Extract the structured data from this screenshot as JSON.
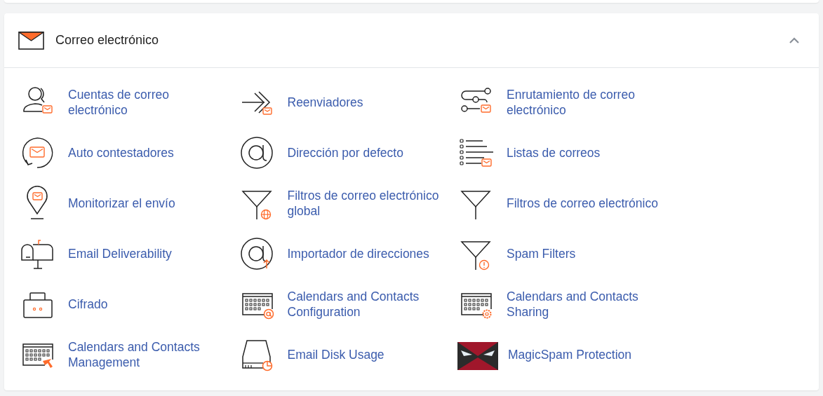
{
  "section": {
    "title": "Correo electrónico",
    "expanded": true
  },
  "items": [
    {
      "label": "Cuentas de correo electrónico",
      "kind": "user-mail"
    },
    {
      "label": "Reenviadores",
      "kind": "forward-mail"
    },
    {
      "label": "Enrutamiento de correo electrónico",
      "kind": "route-mail"
    },
    {
      "label": "Auto contestadores",
      "kind": "autoreply"
    },
    {
      "label": "Dirección por defecto",
      "kind": "at"
    },
    {
      "label": "Listas de correos",
      "kind": "list-mail"
    },
    {
      "label": "Monitorizar el envío",
      "kind": "pin-mail"
    },
    {
      "label": "Filtros de correo electrónico global",
      "kind": "filter-globe"
    },
    {
      "label": "Filtros de correo electrónico",
      "kind": "filter"
    },
    {
      "label": "Email Deliverability",
      "kind": "mailbox"
    },
    {
      "label": "Importador de direcciones",
      "kind": "at-upload"
    },
    {
      "label": "Spam Filters",
      "kind": "filter-alert"
    },
    {
      "label": "Cifrado",
      "kind": "lock"
    },
    {
      "label": "Calendars and Contacts Configuration",
      "kind": "calendar-at"
    },
    {
      "label": "Calendars and Contacts Sharing",
      "kind": "calendar-gear"
    },
    {
      "label": "Calendars and Contacts Management",
      "kind": "calendar-cursor"
    },
    {
      "label": "Email Disk Usage",
      "kind": "disk-chart"
    },
    {
      "label": "MagicSpam Protection",
      "kind": "logo"
    }
  ]
}
